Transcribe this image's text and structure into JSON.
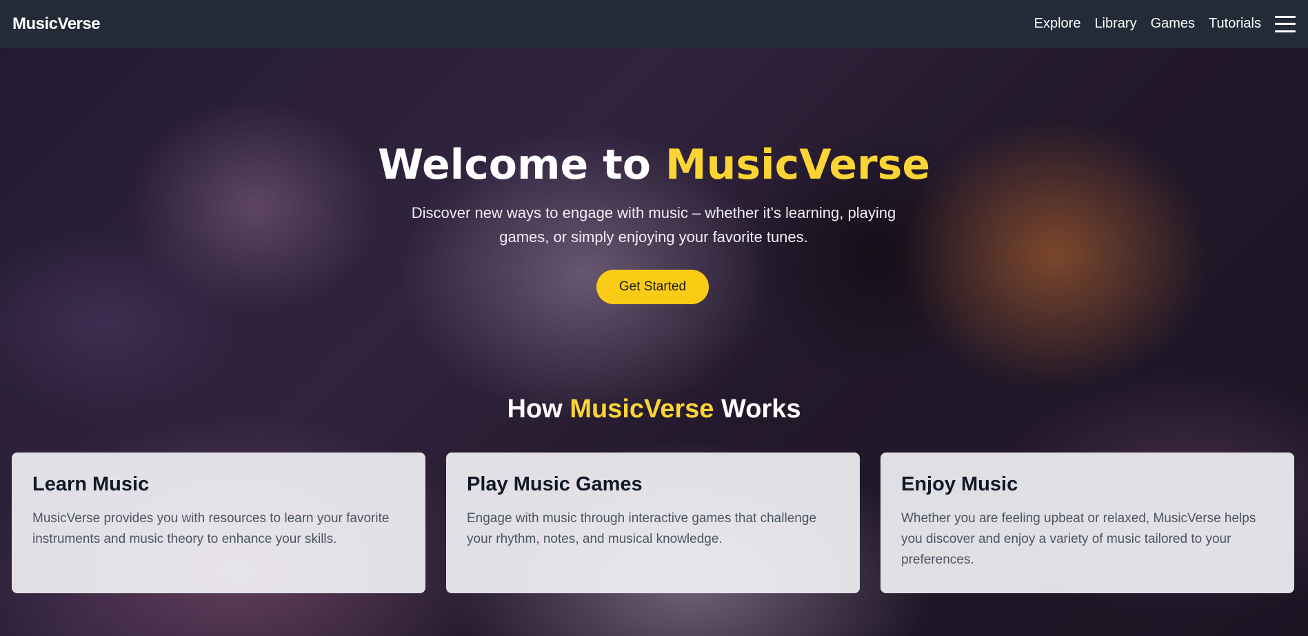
{
  "navbar": {
    "brand": "MusicVerse",
    "links": [
      "Explore",
      "Library",
      "Games",
      "Tutorials"
    ],
    "menu_icon": "hamburger-menu-icon"
  },
  "hero": {
    "title_prefix": "Welcome to ",
    "title_accent": "MusicVerse",
    "subtitle": "Discover new ways to engage with music – whether it's learning, playing games, or simply enjoying your favorite tunes.",
    "cta_label": "Get Started"
  },
  "how_it_works": {
    "title_prefix": "How ",
    "title_accent": "MusicVerse",
    "title_suffix": " Works",
    "cards": [
      {
        "title": "Learn Music",
        "text": "MusicVerse provides you with resources to learn your favorite instruments and music theory to enhance your skills."
      },
      {
        "title": "Play Music Games",
        "text": "Engage with music through interactive games that challenge your rhythm, notes, and musical knowledge."
      },
      {
        "title": "Enjoy Music",
        "text": "Whether you are feeling upbeat or relaxed, MusicVerse helps you discover and enjoy a variety of music tailored to your preferences."
      }
    ]
  },
  "colors": {
    "navbar_bg": "#232b38",
    "accent": "#fcd535",
    "button_bg": "#facc15"
  }
}
